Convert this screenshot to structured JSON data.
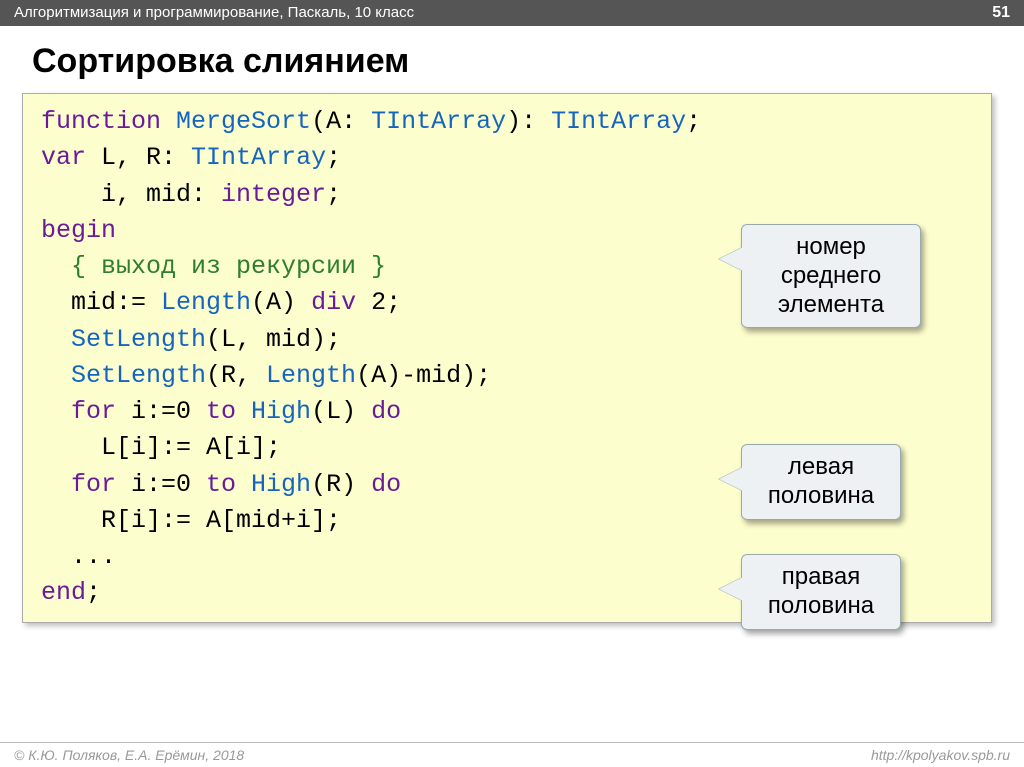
{
  "header": {
    "course": "Алгоритмизация и программирование, Паскаль, 10 класс",
    "page": "51"
  },
  "title": "Сортировка слиянием",
  "callouts": {
    "mid": "номер\nсреднего\nэлемента",
    "left": "левая\nполовина",
    "right": "правая\nполовина"
  },
  "code": {
    "l01a": "function",
    "l01b": " MergeSort",
    "l01c": "(A: ",
    "l01d": "TIntArray",
    "l01e": "): ",
    "l01f": "TIntArray",
    "l01g": ";",
    "l02a": "var",
    "l02b": " L, R: ",
    "l02c": "TIntArray",
    "l02d": ";",
    "l03a": "    i, mid: ",
    "l03b": "integer",
    "l03c": ";",
    "l04a": "begin",
    "l05a": "  { выход из рекурсии }",
    "l06a": "  mid:= ",
    "l06b": "Length",
    "l06c": "(A) ",
    "l06d": "div",
    "l06e": " 2;",
    "l07a": "  SetLength",
    "l07b": "(L, mid);",
    "l08a": "  SetLength",
    "l08b": "(R, ",
    "l08c": "Length",
    "l08d": "(A)-mid);",
    "l09a": "  for",
    "l09b": " i:=0 ",
    "l09c": "to",
    "l09d": " High",
    "l09e": "(L) ",
    "l09f": "do",
    "l10a": "    L[i]:= A[i];",
    "l11a": "  for",
    "l11b": " i:=0 ",
    "l11c": "to",
    "l11d": " High",
    "l11e": "(R) ",
    "l11f": "do",
    "l12a": "    R[i]:= A[mid+i];",
    "l13a": "  ...",
    "l14a": "end",
    "l14b": ";"
  },
  "footer": {
    "authors": "© К.Ю. Поляков, Е.А. Ерёмин, 2018",
    "url": "http://kpolyakov.spb.ru"
  }
}
